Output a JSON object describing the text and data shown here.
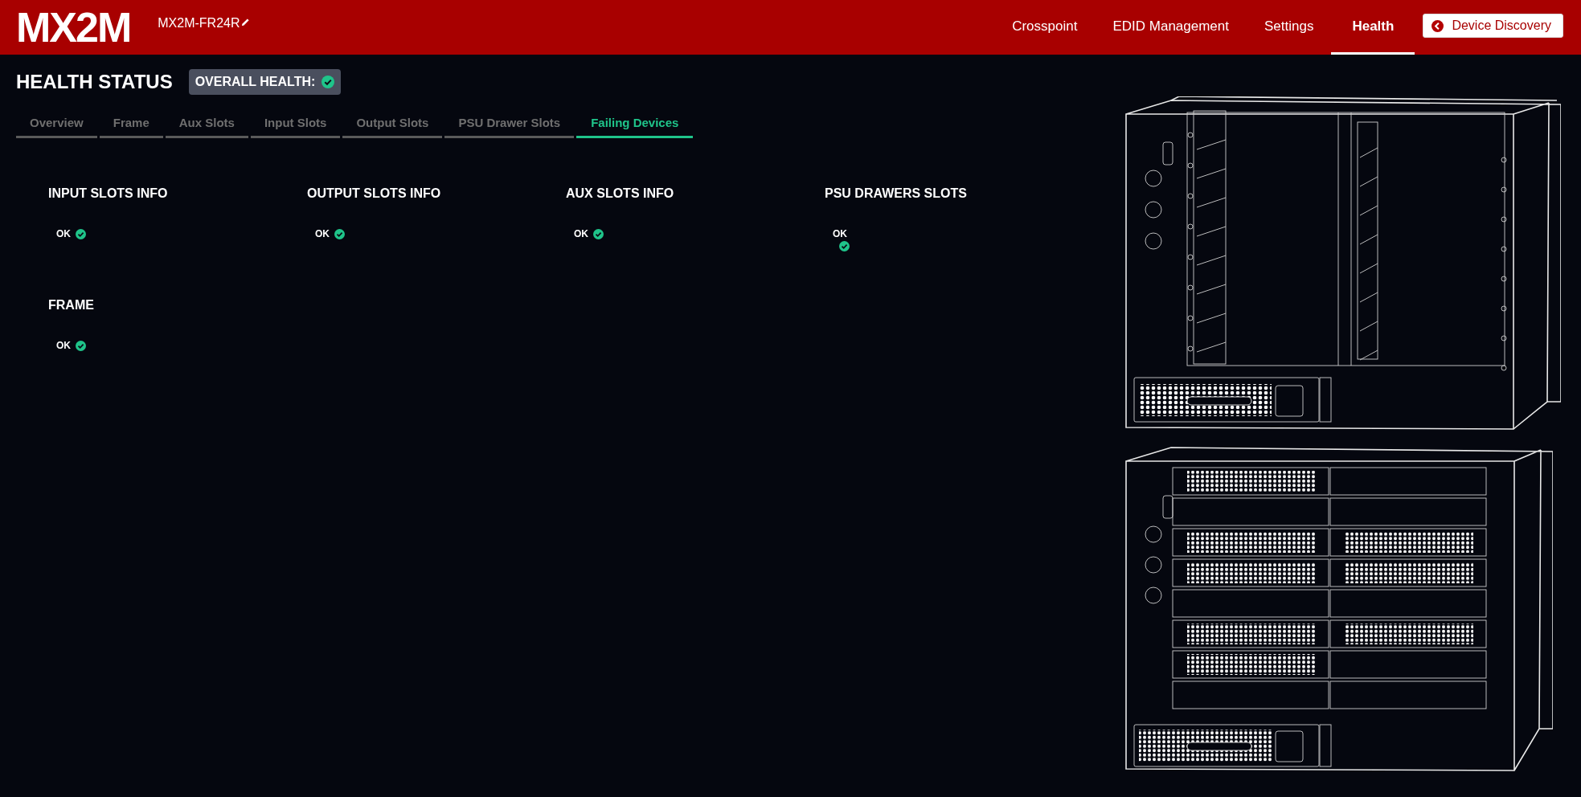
{
  "header": {
    "logo": "MX2M",
    "device_name": "MX2M-FR24R",
    "nav": [
      {
        "label": "Crosspoint",
        "selected": false
      },
      {
        "label": "EDID Management",
        "selected": false
      },
      {
        "label": "Settings",
        "selected": false
      },
      {
        "label": "Health",
        "selected": true
      }
    ],
    "discovery_button": "Device Discovery"
  },
  "title": "HEALTH STATUS",
  "overall_health": {
    "label": "OVERALL HEALTH:",
    "ok": true
  },
  "tabs": [
    {
      "label": "Overview",
      "selected": false
    },
    {
      "label": "Frame",
      "selected": false
    },
    {
      "label": "Aux Slots",
      "selected": false
    },
    {
      "label": "Input Slots",
      "selected": false
    },
    {
      "label": "Output Slots",
      "selected": false
    },
    {
      "label": "PSU Drawer Slots",
      "selected": false
    },
    {
      "label": "Failing Devices",
      "selected": true
    }
  ],
  "sections": [
    {
      "title": "INPUT SLOTS INFO",
      "status": "OK",
      "ok": true
    },
    {
      "title": "OUTPUT SLOTS INFO",
      "status": "OK",
      "ok": true
    },
    {
      "title": "AUX SLOTS INFO",
      "status": "OK",
      "ok": true
    },
    {
      "title": "PSU DRAWERS SLOTS",
      "status": "OK",
      "ok": true
    },
    {
      "title": "FRAME",
      "status": "OK",
      "ok": true
    }
  ]
}
